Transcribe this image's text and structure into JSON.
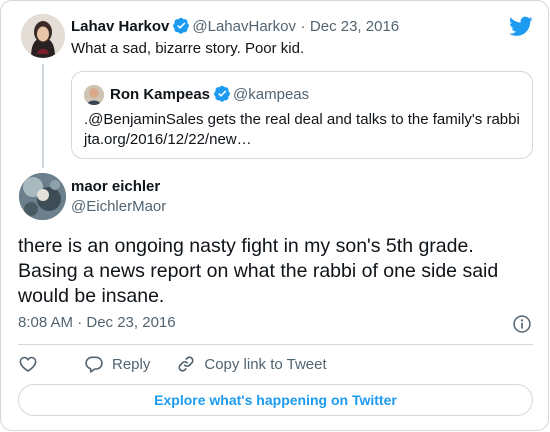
{
  "parent_tweet": {
    "author_name": "Lahav Harkov",
    "author_handle": "@LahavHarkov",
    "separator": "·",
    "date": "Dec 23, 2016",
    "text": "What a sad, bizarre story. Poor kid."
  },
  "quoted_tweet": {
    "author_name": "Ron Kampeas",
    "author_handle": "@kampeas",
    "text_line1": ".@BenjaminSales gets the real deal and talks to the family's rabbi",
    "text_line2": "jta.org/2016/12/22/new…"
  },
  "main_tweet": {
    "author_name": "maor eichler",
    "author_handle": "@EichlerMaor",
    "text": "there is an ongoing nasty fight in my son's 5th grade. Basing a news report on what the rabbi of one side said would be insane.",
    "timestamp": "8:08 AM · Dec 23, 2016"
  },
  "actions": {
    "reply_label": "Reply",
    "copy_link_label": "Copy link to Tweet"
  },
  "explore_label": "Explore what's happening on Twitter",
  "colors": {
    "accent": "#1d9bf0",
    "text": "#0f1419",
    "muted": "#536471",
    "border": "#cfd9de"
  },
  "icons": [
    "verified-badge-icon",
    "twitter-bird-icon",
    "info-icon",
    "heart-icon",
    "reply-icon",
    "link-icon"
  ]
}
